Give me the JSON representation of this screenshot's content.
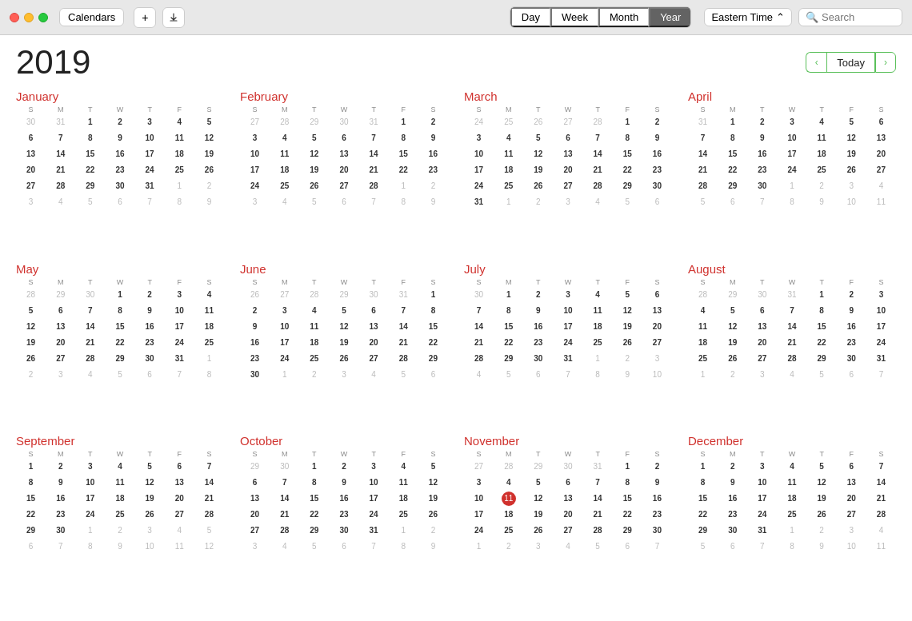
{
  "titleBar": {
    "calendarsLabel": "Calendars",
    "addLabel": "+",
    "exportLabel": "↓",
    "tabs": [
      "Day",
      "Week",
      "Month",
      "Year"
    ],
    "activeTab": "Year",
    "timezone": "Eastern Time",
    "searchPlaceholder": "Search"
  },
  "yearTitle": "2019",
  "nav": {
    "todayLabel": "Today"
  },
  "months": [
    {
      "name": "January",
      "dayHeaders": [
        "S",
        "M",
        "T",
        "W",
        "T",
        "F",
        "S"
      ],
      "weeks": [
        [
          "30",
          "31",
          "1",
          "2",
          "3",
          "4",
          "5"
        ],
        [
          "6",
          "7",
          "8",
          "9",
          "10",
          "11",
          "12"
        ],
        [
          "13",
          "14",
          "15",
          "16",
          "17",
          "18",
          "19"
        ],
        [
          "20",
          "21",
          "22",
          "23",
          "24",
          "25",
          "26"
        ],
        [
          "27",
          "28",
          "29",
          "30",
          "31",
          "1",
          "2"
        ],
        [
          "3",
          "4",
          "5",
          "6",
          "7",
          "8",
          "9"
        ]
      ],
      "boldDays": [
        "1",
        "2",
        "3",
        "4",
        "5",
        "6",
        "7",
        "8",
        "9",
        "10",
        "11",
        "12",
        "13",
        "14",
        "15",
        "16",
        "17",
        "18",
        "19",
        "20",
        "21",
        "22",
        "23",
        "24",
        "25",
        "26",
        "27",
        "28",
        "29",
        "30",
        "31"
      ],
      "grayDays": [
        "30",
        "31",
        "1",
        "2",
        "3",
        "4",
        "5",
        "6",
        "7",
        "8",
        "9"
      ],
      "grayPositions": [
        [
          0,
          0
        ],
        [
          0,
          1
        ],
        [
          4,
          5
        ],
        [
          4,
          6
        ],
        [
          5,
          0
        ],
        [
          5,
          1
        ],
        [
          5,
          2
        ],
        [
          5,
          3
        ],
        [
          5,
          4
        ],
        [
          5,
          5
        ],
        [
          5,
          6
        ]
      ]
    },
    {
      "name": "February",
      "dayHeaders": [
        "S",
        "M",
        "T",
        "W",
        "T",
        "F",
        "S"
      ],
      "weeks": [
        [
          "27",
          "28",
          "29",
          "30",
          "31",
          "1",
          "2"
        ],
        [
          "3",
          "4",
          "5",
          "6",
          "7",
          "8",
          "9"
        ],
        [
          "10",
          "11",
          "12",
          "13",
          "14",
          "15",
          "16"
        ],
        [
          "17",
          "18",
          "19",
          "20",
          "21",
          "22",
          "23"
        ],
        [
          "24",
          "25",
          "26",
          "27",
          "28",
          "1",
          "2"
        ],
        [
          "3",
          "4",
          "5",
          "6",
          "7",
          "8",
          "9"
        ]
      ],
      "grayPositions": [
        [
          0,
          0
        ],
        [
          0,
          1
        ],
        [
          0,
          2
        ],
        [
          0,
          3
        ],
        [
          0,
          4
        ],
        [
          4,
          5
        ],
        [
          4,
          6
        ],
        [
          5,
          0
        ],
        [
          5,
          1
        ],
        [
          5,
          2
        ],
        [
          5,
          3
        ],
        [
          5,
          4
        ],
        [
          5,
          5
        ],
        [
          5,
          6
        ]
      ]
    },
    {
      "name": "March",
      "dayHeaders": [
        "S",
        "M",
        "T",
        "W",
        "T",
        "F",
        "S"
      ],
      "weeks": [
        [
          "24",
          "25",
          "26",
          "27",
          "28",
          "1",
          "2"
        ],
        [
          "3",
          "4",
          "5",
          "6",
          "7",
          "8",
          "9"
        ],
        [
          "10",
          "11",
          "12",
          "13",
          "14",
          "15",
          "16"
        ],
        [
          "17",
          "18",
          "19",
          "20",
          "21",
          "22",
          "23"
        ],
        [
          "24",
          "25",
          "26",
          "27",
          "28",
          "29",
          "30"
        ],
        [
          "31",
          "1",
          "2",
          "3",
          "4",
          "5",
          "6"
        ]
      ],
      "grayPositions": [
        [
          0,
          0
        ],
        [
          0,
          1
        ],
        [
          0,
          2
        ],
        [
          0,
          3
        ],
        [
          0,
          4
        ],
        [
          5,
          1
        ],
        [
          5,
          2
        ],
        [
          5,
          3
        ],
        [
          5,
          4
        ],
        [
          5,
          5
        ],
        [
          5,
          6
        ]
      ]
    },
    {
      "name": "April",
      "dayHeaders": [
        "S",
        "M",
        "T",
        "W",
        "T",
        "F",
        "S"
      ],
      "weeks": [
        [
          "31",
          "1",
          "2",
          "3",
          "4",
          "5",
          "6"
        ],
        [
          "7",
          "8",
          "9",
          "10",
          "11",
          "12",
          "13"
        ],
        [
          "14",
          "15",
          "16",
          "17",
          "18",
          "19",
          "20"
        ],
        [
          "21",
          "22",
          "23",
          "24",
          "25",
          "26",
          "27"
        ],
        [
          "28",
          "29",
          "30",
          "1",
          "2",
          "3",
          "4"
        ],
        [
          "5",
          "6",
          "7",
          "8",
          "9",
          "10",
          "11"
        ]
      ],
      "grayPositions": [
        [
          0,
          0
        ],
        [
          4,
          3
        ],
        [
          4,
          4
        ],
        [
          4,
          5
        ],
        [
          4,
          6
        ],
        [
          5,
          0
        ],
        [
          5,
          1
        ],
        [
          5,
          2
        ],
        [
          5,
          3
        ],
        [
          5,
          4
        ],
        [
          5,
          5
        ],
        [
          5,
          6
        ]
      ]
    },
    {
      "name": "May",
      "dayHeaders": [
        "S",
        "M",
        "T",
        "W",
        "T",
        "F",
        "S"
      ],
      "weeks": [
        [
          "28",
          "29",
          "30",
          "1",
          "2",
          "3",
          "4"
        ],
        [
          "5",
          "6",
          "7",
          "8",
          "9",
          "10",
          "11"
        ],
        [
          "12",
          "13",
          "14",
          "15",
          "16",
          "17",
          "18"
        ],
        [
          "19",
          "20",
          "21",
          "22",
          "23",
          "24",
          "25"
        ],
        [
          "26",
          "27",
          "28",
          "29",
          "30",
          "31",
          "1"
        ],
        [
          "2",
          "3",
          "4",
          "5",
          "6",
          "7",
          "8"
        ]
      ],
      "grayPositions": [
        [
          0,
          0
        ],
        [
          0,
          1
        ],
        [
          0,
          2
        ],
        [
          4,
          6
        ],
        [
          5,
          0
        ],
        [
          5,
          1
        ],
        [
          5,
          2
        ],
        [
          5,
          3
        ],
        [
          5,
          4
        ],
        [
          5,
          5
        ],
        [
          5,
          6
        ]
      ]
    },
    {
      "name": "June",
      "dayHeaders": [
        "S",
        "M",
        "T",
        "W",
        "T",
        "F",
        "S"
      ],
      "weeks": [
        [
          "26",
          "27",
          "28",
          "29",
          "30",
          "31",
          "1"
        ],
        [
          "2",
          "3",
          "4",
          "5",
          "6",
          "7",
          "8"
        ],
        [
          "9",
          "10",
          "11",
          "12",
          "13",
          "14",
          "15"
        ],
        [
          "16",
          "17",
          "18",
          "19",
          "20",
          "21",
          "22"
        ],
        [
          "23",
          "24",
          "25",
          "26",
          "27",
          "28",
          "29"
        ],
        [
          "30",
          "1",
          "2",
          "3",
          "4",
          "5",
          "6"
        ]
      ],
      "grayPositions": [
        [
          0,
          0
        ],
        [
          0,
          1
        ],
        [
          0,
          2
        ],
        [
          0,
          3
        ],
        [
          0,
          4
        ],
        [
          0,
          5
        ],
        [
          5,
          1
        ],
        [
          5,
          2
        ],
        [
          5,
          3
        ],
        [
          5,
          4
        ],
        [
          5,
          5
        ],
        [
          5,
          6
        ]
      ]
    },
    {
      "name": "July",
      "dayHeaders": [
        "S",
        "M",
        "T",
        "W",
        "T",
        "F",
        "S"
      ],
      "weeks": [
        [
          "30",
          "1",
          "2",
          "3",
          "4",
          "5",
          "6"
        ],
        [
          "7",
          "8",
          "9",
          "10",
          "11",
          "12",
          "13"
        ],
        [
          "14",
          "15",
          "16",
          "17",
          "18",
          "19",
          "20"
        ],
        [
          "21",
          "22",
          "23",
          "24",
          "25",
          "26",
          "27"
        ],
        [
          "28",
          "29",
          "30",
          "31",
          "1",
          "2",
          "3"
        ],
        [
          "4",
          "5",
          "6",
          "7",
          "8",
          "9",
          "10"
        ]
      ],
      "grayPositions": [
        [
          0,
          0
        ],
        [
          4,
          4
        ],
        [
          4,
          5
        ],
        [
          4,
          6
        ],
        [
          5,
          0
        ],
        [
          5,
          1
        ],
        [
          5,
          2
        ],
        [
          5,
          3
        ],
        [
          5,
          4
        ],
        [
          5,
          5
        ],
        [
          5,
          6
        ]
      ]
    },
    {
      "name": "August",
      "dayHeaders": [
        "S",
        "M",
        "T",
        "W",
        "T",
        "F",
        "S"
      ],
      "weeks": [
        [
          "28",
          "29",
          "30",
          "31",
          "1",
          "2",
          "3"
        ],
        [
          "4",
          "5",
          "6",
          "7",
          "8",
          "9",
          "10"
        ],
        [
          "11",
          "12",
          "13",
          "14",
          "15",
          "16",
          "17"
        ],
        [
          "18",
          "19",
          "20",
          "21",
          "22",
          "23",
          "24"
        ],
        [
          "25",
          "26",
          "27",
          "28",
          "29",
          "30",
          "31"
        ],
        [
          "1",
          "2",
          "3",
          "4",
          "5",
          "6",
          "7"
        ]
      ],
      "grayPositions": [
        [
          0,
          0
        ],
        [
          0,
          1
        ],
        [
          0,
          2
        ],
        [
          0,
          3
        ],
        [
          5,
          0
        ],
        [
          5,
          1
        ],
        [
          5,
          2
        ],
        [
          5,
          3
        ],
        [
          5,
          4
        ],
        [
          5,
          5
        ],
        [
          5,
          6
        ]
      ]
    },
    {
      "name": "September",
      "dayHeaders": [
        "S",
        "M",
        "T",
        "W",
        "T",
        "F",
        "S"
      ],
      "weeks": [
        [
          "1",
          "2",
          "3",
          "4",
          "5",
          "6",
          "7"
        ],
        [
          "8",
          "9",
          "10",
          "11",
          "12",
          "13",
          "14"
        ],
        [
          "15",
          "16",
          "17",
          "18",
          "19",
          "20",
          "21"
        ],
        [
          "22",
          "23",
          "24",
          "25",
          "26",
          "27",
          "28"
        ],
        [
          "29",
          "30",
          "1",
          "2",
          "3",
          "4",
          "5"
        ],
        [
          "6",
          "7",
          "8",
          "9",
          "10",
          "11",
          "12"
        ]
      ],
      "grayPositions": [
        [
          4,
          2
        ],
        [
          4,
          3
        ],
        [
          4,
          4
        ],
        [
          4,
          5
        ],
        [
          4,
          6
        ],
        [
          5,
          0
        ],
        [
          5,
          1
        ],
        [
          5,
          2
        ],
        [
          5,
          3
        ],
        [
          5,
          4
        ],
        [
          5,
          5
        ],
        [
          5,
          6
        ]
      ]
    },
    {
      "name": "October",
      "dayHeaders": [
        "S",
        "M",
        "T",
        "W",
        "T",
        "F",
        "S"
      ],
      "weeks": [
        [
          "29",
          "30",
          "1",
          "2",
          "3",
          "4",
          "5"
        ],
        [
          "6",
          "7",
          "8",
          "9",
          "10",
          "11",
          "12"
        ],
        [
          "13",
          "14",
          "15",
          "16",
          "17",
          "18",
          "19"
        ],
        [
          "20",
          "21",
          "22",
          "23",
          "24",
          "25",
          "26"
        ],
        [
          "27",
          "28",
          "29",
          "30",
          "31",
          "1",
          "2"
        ],
        [
          "3",
          "4",
          "5",
          "6",
          "7",
          "8",
          "9"
        ]
      ],
      "grayPositions": [
        [
          0,
          0
        ],
        [
          0,
          1
        ],
        [
          4,
          5
        ],
        [
          4,
          6
        ],
        [
          5,
          0
        ],
        [
          5,
          1
        ],
        [
          5,
          2
        ],
        [
          5,
          3
        ],
        [
          5,
          4
        ],
        [
          5,
          5
        ],
        [
          5,
          6
        ]
      ]
    },
    {
      "name": "November",
      "dayHeaders": [
        "S",
        "M",
        "T",
        "W",
        "T",
        "F",
        "S"
      ],
      "weeks": [
        [
          "27",
          "28",
          "29",
          "30",
          "31",
          "1",
          "2"
        ],
        [
          "3",
          "4",
          "5",
          "6",
          "7",
          "8",
          "9"
        ],
        [
          "10",
          "11",
          "12",
          "13",
          "14",
          "15",
          "16"
        ],
        [
          "17",
          "18",
          "19",
          "20",
          "21",
          "22",
          "23"
        ],
        [
          "24",
          "25",
          "26",
          "27",
          "28",
          "29",
          "30"
        ],
        [
          "1",
          "2",
          "3",
          "4",
          "5",
          "6",
          "7"
        ]
      ],
      "grayPositions": [
        [
          0,
          0
        ],
        [
          0,
          1
        ],
        [
          0,
          2
        ],
        [
          0,
          3
        ],
        [
          0,
          4
        ],
        [
          5,
          0
        ],
        [
          5,
          1
        ],
        [
          5,
          2
        ],
        [
          5,
          3
        ],
        [
          5,
          4
        ],
        [
          5,
          5
        ],
        [
          5,
          6
        ]
      ],
      "todayPosition": [
        2,
        1
      ]
    },
    {
      "name": "December",
      "dayHeaders": [
        "S",
        "M",
        "T",
        "W",
        "T",
        "F",
        "S"
      ],
      "weeks": [
        [
          "1",
          "2",
          "3",
          "4",
          "5",
          "6",
          "7"
        ],
        [
          "8",
          "9",
          "10",
          "11",
          "12",
          "13",
          "14"
        ],
        [
          "15",
          "16",
          "17",
          "18",
          "19",
          "20",
          "21"
        ],
        [
          "22",
          "23",
          "24",
          "25",
          "26",
          "27",
          "28"
        ],
        [
          "29",
          "30",
          "31",
          "1",
          "2",
          "3",
          "4"
        ],
        [
          "5",
          "6",
          "7",
          "8",
          "9",
          "10",
          "11"
        ]
      ],
      "grayPositions": [
        [
          4,
          3
        ],
        [
          4,
          4
        ],
        [
          4,
          5
        ],
        [
          4,
          6
        ],
        [
          5,
          0
        ],
        [
          5,
          1
        ],
        [
          5,
          2
        ],
        [
          5,
          3
        ],
        [
          5,
          4
        ],
        [
          5,
          5
        ],
        [
          5,
          6
        ]
      ]
    }
  ]
}
